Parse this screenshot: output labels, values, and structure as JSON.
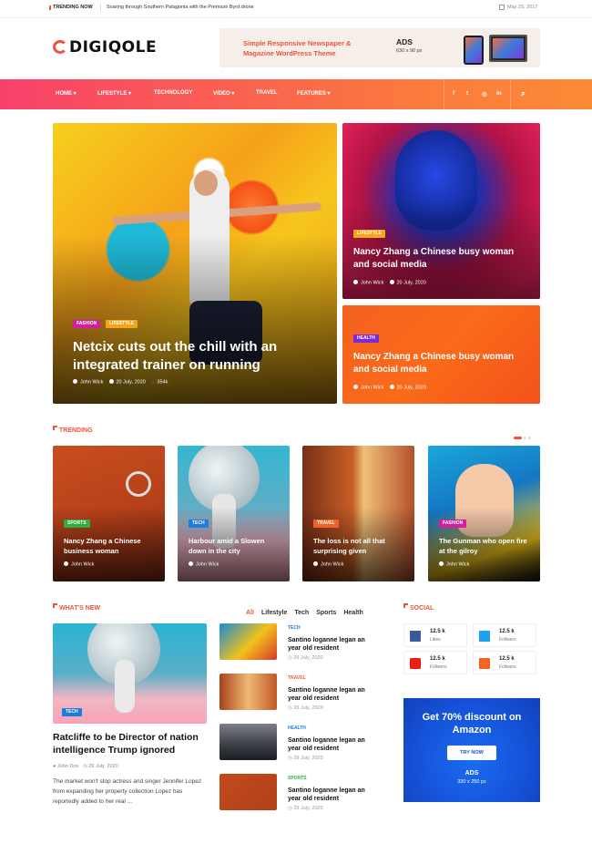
{
  "topbar": {
    "trending_label": "TRENDING NOW",
    "trending_title": "Soaring through Southern Patagonia with the Premium Byrd drone",
    "date": "May 29, 2017"
  },
  "brand": {
    "logo": "DIGIQOLE",
    "accent": "#f1523b"
  },
  "header_ad": {
    "text": "Simple Responsive Newspaper & Magazine WordPress Theme",
    "label": "ADS",
    "size": "630 x 90 px"
  },
  "nav": {
    "items": [
      "HOME",
      "LIFESTYLE",
      "TECHNOLOGY",
      "VIDEO",
      "TRAVEL",
      "FEATURES"
    ],
    "social": [
      "f",
      "t",
      "ig",
      "in"
    ]
  },
  "hero": {
    "main": {
      "badges": [
        "FASHION",
        "LIFESTYLE"
      ],
      "title": "Netcix cuts out the chill with an integrated trainer on running",
      "author": "John Wick",
      "date": "20 July, 2020",
      "views": "354k"
    },
    "r1": {
      "badge": "LIFESTYLE",
      "title": "Nancy Zhang a Chinese busy woman and social media",
      "author": "John Wick",
      "date": "20 July, 2020"
    },
    "r2": {
      "badge": "HEALTH",
      "title": "Nancy Zhang a Chinese busy woman and social media",
      "author": "John Wick",
      "date": "20 July, 2020"
    }
  },
  "trending": {
    "heading": "TRENDING",
    "cards": [
      {
        "badge": "SPORTS",
        "title": "Nancy Zhang a Chinese business woman",
        "author": "John Wick"
      },
      {
        "badge": "TECH",
        "title": "Harbour amid a Slowen down in the city",
        "author": "John Wick"
      },
      {
        "badge": "TRAVEL",
        "title": "The loss is not all that surprising given",
        "author": "John Wick"
      },
      {
        "badge": "FASHION",
        "title": "The Gunman who open fire at the gilroy",
        "author": "John Wick"
      }
    ]
  },
  "whats_new": {
    "heading": "WHAT'S NEW",
    "tabs": [
      "All",
      "Lifestyle",
      "Tech",
      "Sports",
      "Health"
    ],
    "featured": {
      "badge": "TECH",
      "title": "Ratcliffe to be Director of nation intelligence Trump ignored",
      "author": "John Doe",
      "date": "29 July, 2020",
      "desc": "The market won't stop actress and singer Jennifer Lopez from expanding her property collection Lopez has reportedly added to her real ..."
    },
    "list": [
      {
        "cat": "TECH",
        "title": "Santino loganne legan an year old resident",
        "date": "29 July, 2020"
      },
      {
        "cat": "TRAVEL",
        "title": "Santino loganne legan an year old resident",
        "date": "29 July, 2020"
      },
      {
        "cat": "HEALTH",
        "title": "Santino loganne legan an year old resident",
        "date": "29 July, 2020"
      },
      {
        "cat": "SPORTS",
        "title": "Santino loganne legan an year old resident",
        "date": "29 July, 2020"
      }
    ]
  },
  "social": {
    "heading": "SOCIAL",
    "items": [
      {
        "icon": "facebook-icon",
        "count": "12.5 k",
        "label": "Likes",
        "color": "#3b5998"
      },
      {
        "icon": "twitter-icon",
        "count": "12.5 k",
        "label": "Follwers",
        "color": "#1da1f2"
      },
      {
        "icon": "youtube-icon",
        "count": "12.5 k",
        "label": "Follwers",
        "color": "#e62117"
      },
      {
        "icon": "rss-icon",
        "count": "12.5 k",
        "label": "Follwers",
        "color": "#f26522"
      }
    ]
  },
  "promo": {
    "title": "Get 70% discount on Amazon",
    "button": "TRY NOW",
    "ads": "ADS",
    "size": "330 x 250 px"
  }
}
